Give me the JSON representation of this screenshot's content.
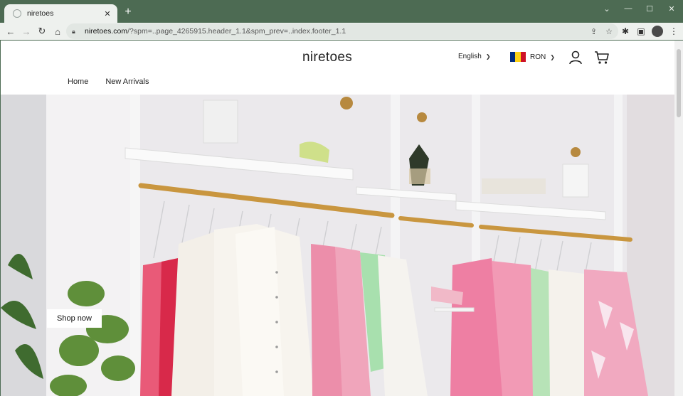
{
  "browser": {
    "tab_title": "niretoes",
    "url_host": "niretoes.com",
    "url_path": "/?spm=..page_4265915.header_1.1&spm_prev=..index.footer_1.1"
  },
  "header": {
    "logo": "niretoes",
    "language": "English",
    "currency": "RON",
    "flag_colors": [
      "#002B7F",
      "#FCD116",
      "#CE1126"
    ]
  },
  "nav": {
    "items": [
      {
        "label": "Home"
      },
      {
        "label": "New Arrivals"
      }
    ]
  },
  "hero": {
    "cta_label": "Shop now"
  },
  "colors": {
    "browser_frame": "#4d6b53",
    "toolbar": "#eef1ee"
  }
}
